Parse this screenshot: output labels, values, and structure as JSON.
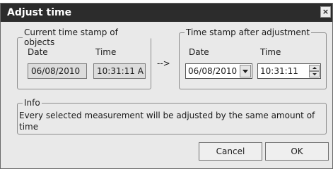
{
  "dialog": {
    "title": "Adjust time",
    "close_symbol": "×"
  },
  "current_group": {
    "legend": "Current time stamp of objects",
    "date_label": "Date",
    "time_label": "Time",
    "date_value": "06/08/2010",
    "time_value": "10:31:11 A"
  },
  "arrow_text": "-->",
  "adjusted_group": {
    "legend": "Time stamp after adjustment",
    "date_label": "Date",
    "time_label": "Time",
    "date_value": "06/08/2010",
    "time_value": "10:31:11"
  },
  "info_group": {
    "legend": "Info",
    "text": "Every selected measurement will be adjusted by the same amount of time"
  },
  "buttons": {
    "cancel": "Cancel",
    "ok": "OK"
  },
  "icons": {
    "close": "close-icon",
    "dropdown": "chevron-down-icon",
    "spin_up": "spin-up-icon",
    "spin_down": "spin-down-icon"
  }
}
